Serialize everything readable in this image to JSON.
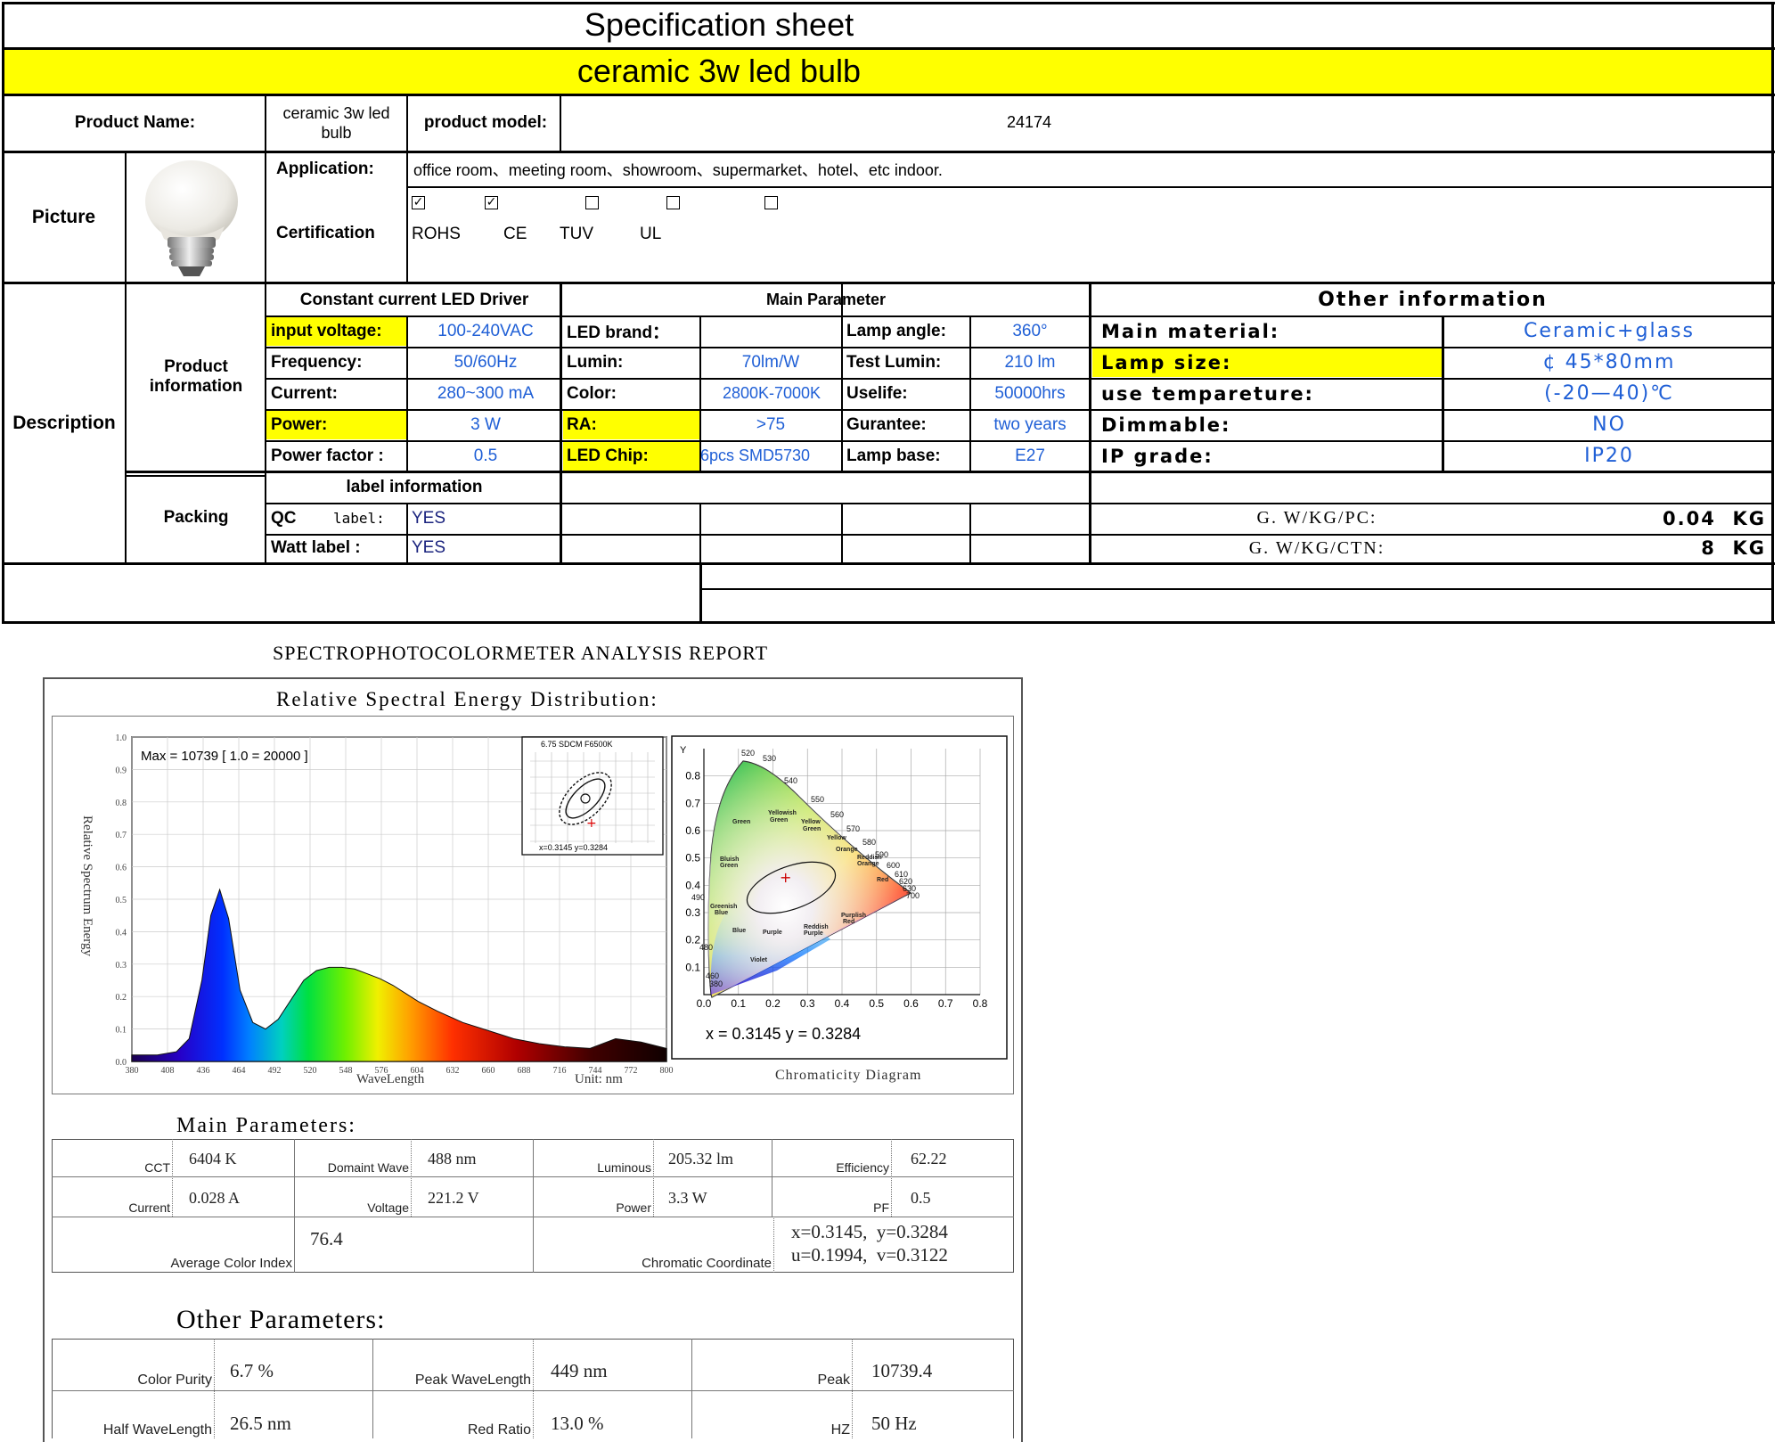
{
  "sheet": {
    "title": "Specification sheet",
    "subtitle": "ceramic 3w led bulb",
    "product_name_label": "Product Name:",
    "product_name_value": "ceramic 3w led bulb",
    "product_model_label": "product model:",
    "product_model_value": "24174",
    "picture_label": "Picture",
    "application_label": "Application:",
    "application_value": "office room、meeting room、showroom、supermarket、hotel、etc indoor.",
    "certification_label": "Certification",
    "certifications": [
      {
        "label": "ROHS",
        "checked": true
      },
      {
        "label": "CE",
        "checked": true
      },
      {
        "label": "TUV",
        "checked": false
      },
      {
        "label": "UL",
        "checked": false
      },
      {
        "label": "",
        "checked": false
      }
    ],
    "description_label": "Description",
    "product_info_label": "Product information",
    "packing_label": "Packing",
    "driver_header": "Constant current LED Driver",
    "main_param_header": "Main Parameter",
    "other_info_header": "Other information",
    "driver_rows": [
      {
        "label": "input voltage:",
        "value": "100-240VAC"
      },
      {
        "label": "Frequency:",
        "value": "50/60Hz"
      },
      {
        "label": "Current:",
        "value": "280~300 mA"
      },
      {
        "label": "Power:",
        "value": "3 W"
      },
      {
        "label": "Power factor :",
        "value": "0.5"
      }
    ],
    "main_rows": [
      {
        "label": "LED brand：",
        "value": "",
        "label2": "Lamp angle:",
        "value2": "360°"
      },
      {
        "label": "Lumin:",
        "value": "70lm/W",
        "label2": "Test Lumin:",
        "value2": "210 lm"
      },
      {
        "label": "Color:",
        "value": "2800K-7000K",
        "label2": "Uselife:",
        "value2": "50000hrs"
      },
      {
        "label": "RA:",
        "value": ">75",
        "label2": "Gurantee:",
        "value2": "two years"
      },
      {
        "label": "LED Chip:",
        "value": "6pcs SMD5730",
        "label2": "Lamp base:",
        "value2": "E27"
      }
    ],
    "other_rows": [
      {
        "label": "Main material:",
        "value": "Ceramic+glass"
      },
      {
        "label": "Lamp size:",
        "value": "¢ 45*80mm"
      },
      {
        "label": "use tempareture:",
        "value": "(-20—40)℃"
      },
      {
        "label": "Dimmable:",
        "value": "NO"
      },
      {
        "label": "IP grade:",
        "value": "IP20"
      }
    ],
    "label_info_header": "label information",
    "qc_label_a": "QC",
    "qc_label_b": "label:",
    "qc_value": "YES",
    "watt_label": "Watt label :",
    "watt_value": "YES",
    "gw_pc_label": "G. W/KG/PC:",
    "gw_pc_value": "0.04  KG",
    "gw_ctn_label": "G. W/KG/CTN:",
    "gw_ctn_value": "8  KG",
    "colors": {
      "highlight": "#ffff00",
      "value_blue": "#1f5fd6",
      "yes_navy": "#1a237e"
    }
  },
  "report": {
    "title": "SPECTROPHOTOCOLORMETER ANALYSIS REPORT",
    "spd_title": "Relative Spectral Energy Distribution:",
    "max_text": "Max = 10739  [ 1.0 = 20000 ]",
    "ylabel": "Relative Spectrum Energy",
    "xlabel": "WaveLength",
    "unit": "Unit:  nm",
    "inset_title": "6.75 SDCM  F6500K",
    "inset_coords": "x=0.3145  y=0.3284",
    "chromaticity_label": "Chromaticity Diagram",
    "xy_readout": "x = 0.3145    y = 0.3284",
    "main_params_title": "Main Parameters:",
    "main_params": [
      {
        "label": "CCT",
        "value": "6404 K"
      },
      {
        "label": "Domaint Wave",
        "value": "488 nm"
      },
      {
        "label": "Luminous",
        "value": "205.32 lm"
      },
      {
        "label": "Efficiency",
        "value": "62.22"
      },
      {
        "label": "Current",
        "value": "0.028 A"
      },
      {
        "label": "Voltage",
        "value": "221.2 V"
      },
      {
        "label": "Power",
        "value": "3.3 W"
      },
      {
        "label": "PF",
        "value": "0.5"
      }
    ],
    "avg_color_index_label": "Average Color Index",
    "avg_color_index_value": "76.4",
    "chromatic_coord_label": "Chromatic Coordinate",
    "chromatic_coord_line1": "x=0.3145,  y=0.3284",
    "chromatic_coord_line2": "u=0.1994,  v=0.3122",
    "other_params_title": "Other Parameters:",
    "other_params": [
      {
        "label": "Color Purity",
        "value": "6.7 %"
      },
      {
        "label": "Peak WaveLength",
        "value": "449 nm"
      },
      {
        "label": "Peak",
        "value": "10739.4"
      },
      {
        "label": "Half WaveLength",
        "value": "26.5 nm"
      },
      {
        "label": "Red Ratio",
        "value": "13.0 %"
      },
      {
        "label": "HZ",
        "value": "50 Hz"
      }
    ]
  },
  "chart_data": [
    {
      "type": "area",
      "title": "Relative Spectral Energy Distribution:",
      "xlabel": "WaveLength",
      "ylabel": "Relative Spectrum Energy",
      "xlim": [
        380,
        800
      ],
      "ylim": [
        0,
        1.0
      ],
      "x_ticks": [
        "380",
        "408",
        "436",
        "464",
        "492",
        "520",
        "548",
        "576",
        "604",
        "632",
        "660",
        "688",
        "716",
        "744",
        "772",
        "800"
      ],
      "y_ticks": [
        "0.0",
        "0.1",
        "0.2",
        "0.3",
        "0.4",
        "0.5",
        "0.6",
        "0.7",
        "0.8",
        "0.9",
        "1.0"
      ],
      "x": [
        380,
        400,
        415,
        425,
        435,
        442,
        449,
        456,
        465,
        475,
        485,
        495,
        505,
        515,
        525,
        535,
        545,
        555,
        565,
        575,
        585,
        595,
        605,
        620,
        640,
        660,
        680,
        700,
        720,
        740,
        760,
        780,
        800
      ],
      "values": [
        0.02,
        0.02,
        0.03,
        0.07,
        0.25,
        0.45,
        0.53,
        0.44,
        0.22,
        0.12,
        0.1,
        0.13,
        0.19,
        0.25,
        0.28,
        0.29,
        0.29,
        0.285,
        0.27,
        0.255,
        0.235,
        0.21,
        0.185,
        0.155,
        0.12,
        0.095,
        0.07,
        0.055,
        0.045,
        0.04,
        0.07,
        0.06,
        0.04
      ]
    },
    {
      "type": "scatter",
      "title": "Chromaticity Diagram",
      "xlim": [
        0,
        0.8
      ],
      "ylim": [
        0,
        0.9
      ],
      "x_ticks": [
        "0.0",
        "0.1",
        "0.2",
        "0.3",
        "0.4",
        "0.5",
        "0.6",
        "0.7",
        "0.8"
      ],
      "y_ticks": [
        "0.1",
        "0.2",
        "0.3",
        "0.4",
        "0.5",
        "0.6",
        "0.7",
        "0.8"
      ],
      "y_axis_label": "Y",
      "point": {
        "x": 0.3145,
        "y": 0.3284
      },
      "locus_labels": [
        "380",
        "460",
        "480",
        "490",
        "520",
        "530",
        "540",
        "550",
        "560",
        "570",
        "580",
        "590",
        "600",
        "610",
        "620",
        "630",
        "700"
      ],
      "regions": [
        "Green",
        "Yellowish Green",
        "Yellow Green",
        "Yellow",
        "Orange",
        "Reddish Orange",
        "Red",
        "Bluish Green",
        "Greenish Blue",
        "Blue",
        "Purple",
        "Reddish Purple",
        "Purplish Red",
        "Violet"
      ]
    }
  ]
}
